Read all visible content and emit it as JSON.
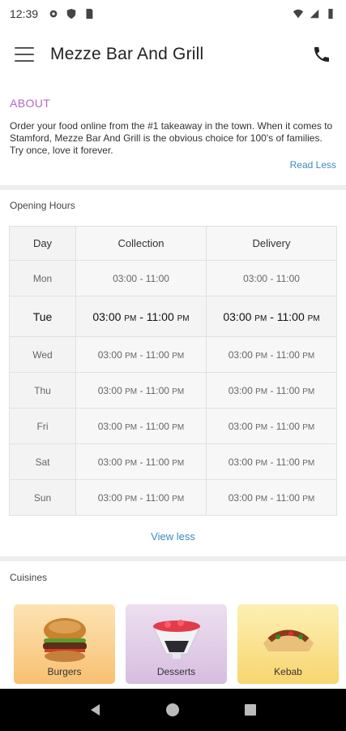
{
  "status_bar": {
    "time": "12:39"
  },
  "app_bar": {
    "title": "Mezze Bar And Grill"
  },
  "about": {
    "heading": "ABOUT",
    "text": "Order your food online from the #1 takeaway in the town. When it comes to Stamford, Mezze Bar And Grill is the obvious choice for 100's of families. Try once, love it forever.",
    "read_less": "Read Less"
  },
  "hours": {
    "title": "Opening Hours",
    "columns": [
      "Day",
      "Collection",
      "Delivery"
    ],
    "rows": [
      {
        "day": "Mon",
        "collection_open": "03:00",
        "collection_open_ampm": "",
        "collection_close": "- 11:00",
        "collection_close_ampm": "",
        "delivery_open": "03:00",
        "delivery_open_ampm": "",
        "delivery_close": "- 11:00",
        "delivery_close_ampm": ""
      },
      {
        "day": "Tue",
        "collection_open": "03:00",
        "collection_open_ampm": "PM",
        "collection_close": "- 11:00",
        "collection_close_ampm": "PM",
        "delivery_open": "03:00",
        "delivery_open_ampm": "PM",
        "delivery_close": "- 11:00",
        "delivery_close_ampm": "PM"
      },
      {
        "day": "Wed",
        "collection_open": "03:00",
        "collection_open_ampm": "PM",
        "collection_close": "- 11:00",
        "collection_close_ampm": "PM",
        "delivery_open": "03:00",
        "delivery_open_ampm": "PM",
        "delivery_close": "- 11:00",
        "delivery_close_ampm": "PM"
      },
      {
        "day": "Thu",
        "collection_open": "03:00",
        "collection_open_ampm": "PM",
        "collection_close": "- 11:00",
        "collection_close_ampm": "PM",
        "delivery_open": "03:00",
        "delivery_open_ampm": "PM",
        "delivery_close": "- 11:00",
        "delivery_close_ampm": "PM"
      },
      {
        "day": "Fri",
        "collection_open": "03:00",
        "collection_open_ampm": "PM",
        "collection_close": "- 11:00",
        "collection_close_ampm": "PM",
        "delivery_open": "03:00",
        "delivery_open_ampm": "PM",
        "delivery_close": "- 11:00",
        "delivery_close_ampm": "PM"
      },
      {
        "day": "Sat",
        "collection_open": "03:00",
        "collection_open_ampm": "PM",
        "collection_close": "- 11:00",
        "collection_close_ampm": "PM",
        "delivery_open": "03:00",
        "delivery_open_ampm": "PM",
        "delivery_close": "- 11:00",
        "delivery_close_ampm": "PM"
      },
      {
        "day": "Sun",
        "collection_open": "03:00",
        "collection_open_ampm": "PM",
        "collection_close": "- 11:00",
        "collection_close_ampm": "PM",
        "delivery_open": "03:00",
        "delivery_open_ampm": "PM",
        "delivery_close": "- 11:00",
        "delivery_close_ampm": "PM"
      }
    ],
    "view_less": "View less"
  },
  "cuisines": {
    "title": "Cuisines",
    "items": [
      {
        "label": "Burgers",
        "icon": "burger-image"
      },
      {
        "label": "Desserts",
        "icon": "dessert-image"
      },
      {
        "label": "Kebab",
        "icon": "kebab-image"
      }
    ]
  },
  "colors": {
    "accent": "#b467c9",
    "link": "#3a8bbb"
  }
}
